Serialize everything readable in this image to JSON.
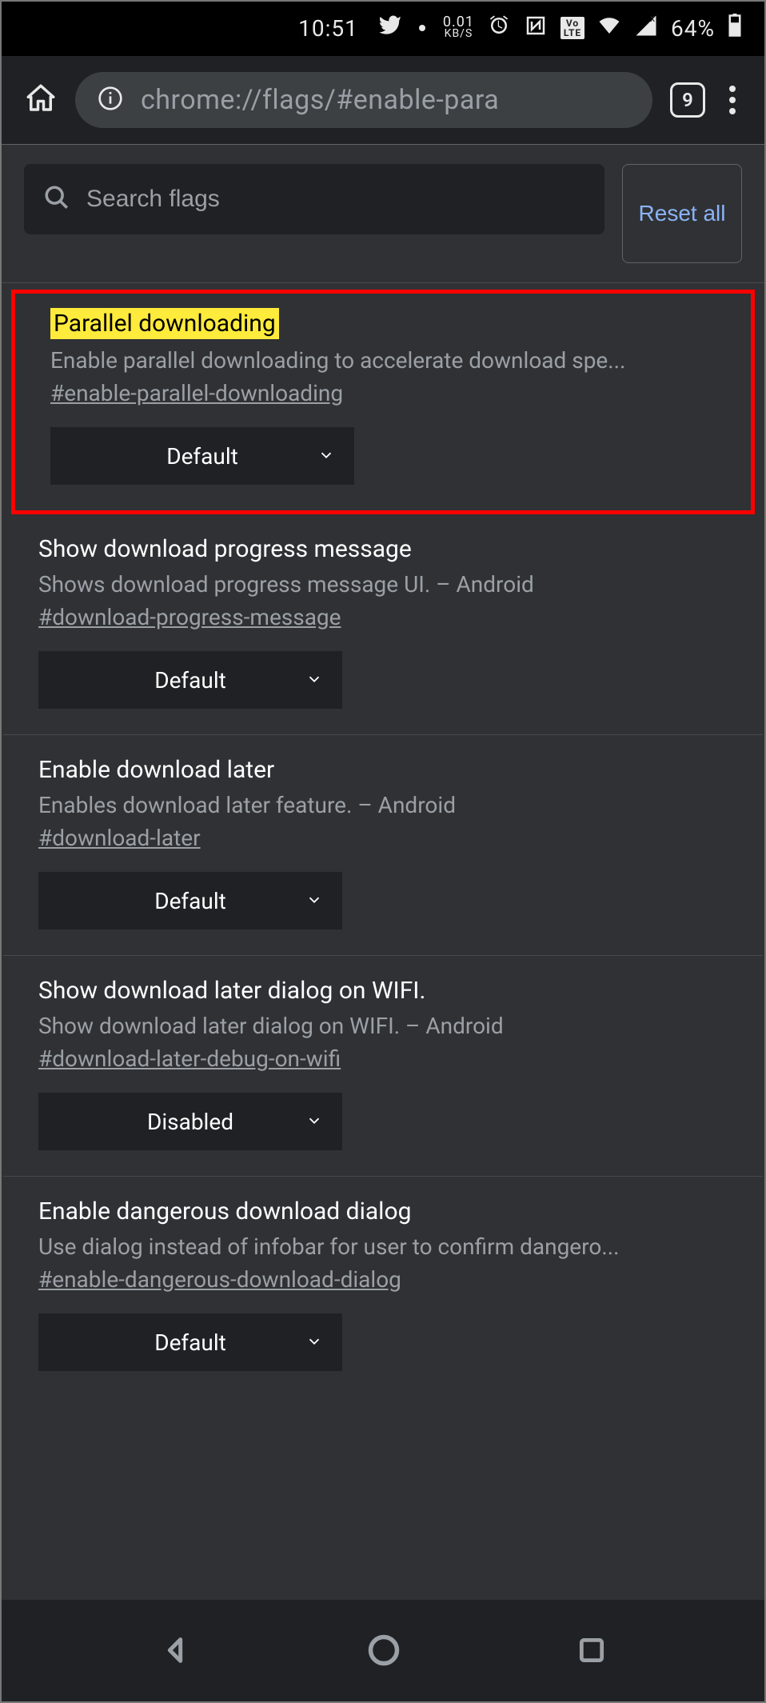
{
  "statusbar": {
    "time": "10:51",
    "net_speed_value": "0.01",
    "net_speed_unit": "KB/S",
    "volte_badge": "Vo LTE",
    "battery_pct": "64%"
  },
  "toolbar": {
    "url": "chrome://flags/#enable-para",
    "tab_count": "9"
  },
  "search": {
    "placeholder": "Search flags",
    "reset_label": "Reset all"
  },
  "flags": [
    {
      "title": "Parallel downloading",
      "desc": "Enable parallel downloading to accelerate download spe...",
      "hash": "#enable-parallel-downloading",
      "value": "Default",
      "highlighted": true,
      "title_hl": true
    },
    {
      "title": "Show download progress message",
      "desc": "Shows download progress message UI. – Android",
      "hash": "#download-progress-message",
      "value": "Default"
    },
    {
      "title": "Enable download later",
      "desc": "Enables download later feature. – Android",
      "hash": "#download-later",
      "value": "Default"
    },
    {
      "title": "Show download later dialog on WIFI.",
      "desc": "Show download later dialog on WIFI. – Android",
      "hash": "#download-later-debug-on-wifi",
      "value": "Disabled"
    },
    {
      "title": "Enable dangerous download dialog",
      "desc": "Use dialog instead of infobar for user to confirm dangero...",
      "hash": "#enable-dangerous-download-dialog",
      "value": "Default"
    }
  ]
}
